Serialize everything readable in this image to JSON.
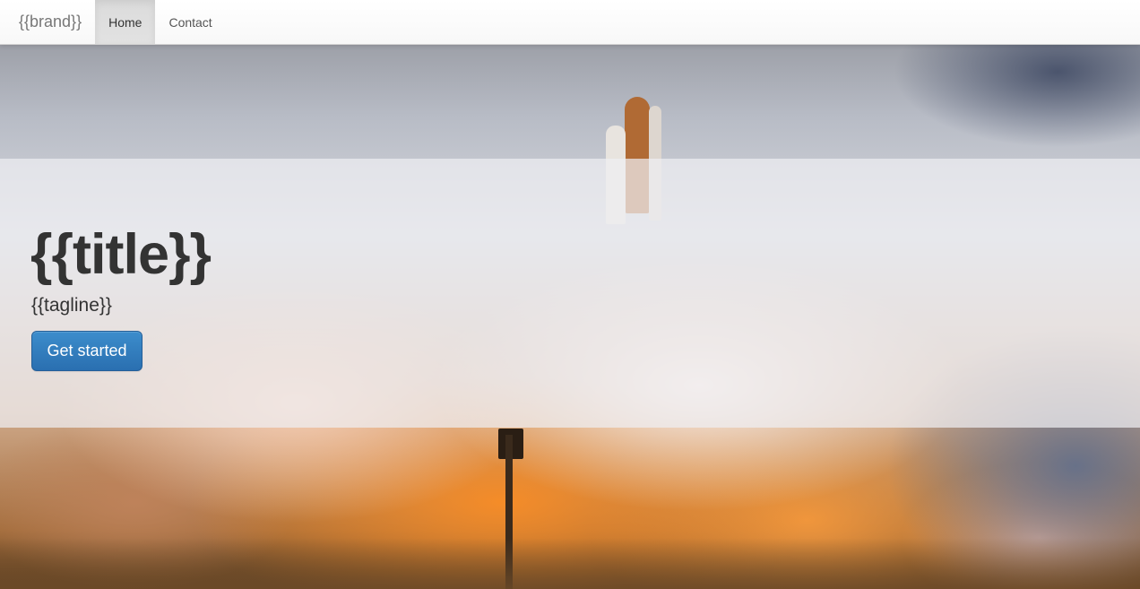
{
  "navbar": {
    "brand": "{{brand}}",
    "items": [
      {
        "label": "Home",
        "active": true
      },
      {
        "label": "Contact",
        "active": false
      }
    ]
  },
  "hero": {
    "title": "{{title}}",
    "tagline": "{{tagline}}",
    "cta_label": "Get started",
    "background_image": "rocket-launch-photo"
  },
  "colors": {
    "cta_button": "#337ab7",
    "navbar_background": "#f8f8f8",
    "text": "#333333",
    "brand_text": "#777777"
  }
}
